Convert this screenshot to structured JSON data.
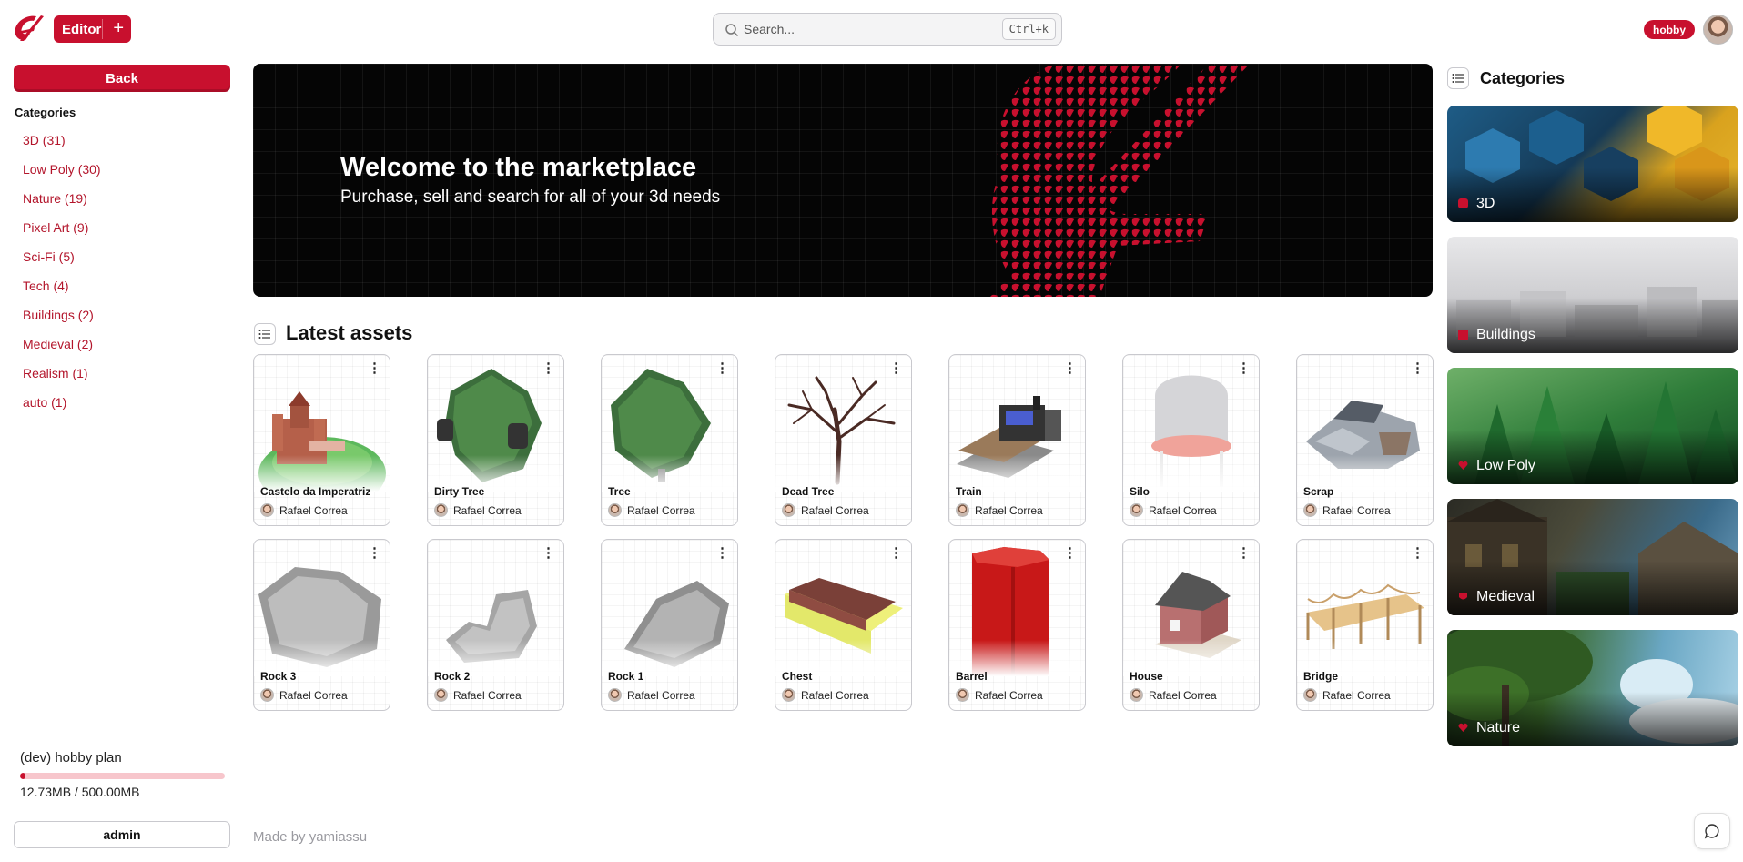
{
  "header": {
    "editor_label": "Editor",
    "search_placeholder": "Search...",
    "search_shortcut": "Ctrl+k",
    "plan_badge": "hobby"
  },
  "sidebar": {
    "back_label": "Back",
    "categories_title": "Categories",
    "categories": [
      {
        "label": "3D (31)"
      },
      {
        "label": "Low Poly (30)"
      },
      {
        "label": "Nature (19)"
      },
      {
        "label": "Pixel Art (9)"
      },
      {
        "label": "Sci-Fi (5)"
      },
      {
        "label": "Tech (4)"
      },
      {
        "label": "Buildings (2)"
      },
      {
        "label": "Medieval (2)"
      },
      {
        "label": "Realism (1)"
      },
      {
        "label": "auto (1)"
      }
    ],
    "plan": {
      "name": "(dev) hobby plan",
      "usage": "12.73MB / 500.00MB",
      "fraction_used": 0.0255
    },
    "user_label": "admin"
  },
  "hero": {
    "title": "Welcome to the marketplace",
    "subtitle": "Purchase, sell and search for all of your 3d needs"
  },
  "latest": {
    "title": "Latest assets",
    "assets": [
      {
        "name": "Castelo da Imperatriz",
        "author": "Rafael Correa"
      },
      {
        "name": "Dirty Tree",
        "author": "Rafael Correa"
      },
      {
        "name": "Tree",
        "author": "Rafael Correa"
      },
      {
        "name": "Dead Tree",
        "author": "Rafael Correa"
      },
      {
        "name": "Train",
        "author": "Rafael Correa"
      },
      {
        "name": "Silo",
        "author": "Rafael Correa"
      },
      {
        "name": "Scrap",
        "author": "Rafael Correa"
      },
      {
        "name": "Rock 3",
        "author": "Rafael Correa"
      },
      {
        "name": "Rock 2",
        "author": "Rafael Correa"
      },
      {
        "name": "Rock 1",
        "author": "Rafael Correa"
      },
      {
        "name": "Chest",
        "author": "Rafael Correa"
      },
      {
        "name": "Barrel",
        "author": "Rafael Correa"
      },
      {
        "name": "House",
        "author": "Rafael Correa"
      },
      {
        "name": "Bridge",
        "author": "Rafael Correa"
      }
    ]
  },
  "categories_panel": {
    "title": "Categories",
    "items": [
      {
        "label": "3D"
      },
      {
        "label": "Buildings"
      },
      {
        "label": "Low Poly"
      },
      {
        "label": "Medieval"
      },
      {
        "label": "Nature"
      }
    ]
  },
  "footer": {
    "text": "Made by yamiassu"
  },
  "colors": {
    "brand": "#c8102e",
    "link": "#b3152b"
  },
  "icons": [
    "logo-icon",
    "plus-icon",
    "search-icon",
    "list-icon",
    "kebab-menu-icon",
    "chat-icon",
    "category-glyph-icon"
  ]
}
